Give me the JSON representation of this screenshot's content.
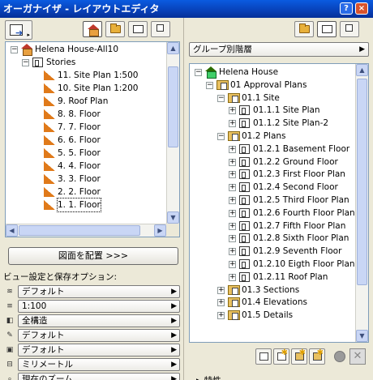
{
  "titlebar": {
    "title": "オーガナイザ - レイアウトエディタ",
    "help": "?",
    "close": "×"
  },
  "left": {
    "tree": {
      "items": [
        {
          "label": "Helena House-All10",
          "indent": 0,
          "expander": "−",
          "icon": "house"
        },
        {
          "label": "Stories",
          "indent": 1,
          "expander": "−",
          "icon": "stories"
        },
        {
          "label": "11. Site Plan 1:500",
          "indent": 2,
          "icon": "story"
        },
        {
          "label": "10. Site Plan 1:200",
          "indent": 2,
          "icon": "story"
        },
        {
          "label": "9. Roof Plan",
          "indent": 2,
          "icon": "story"
        },
        {
          "label": "8. 8. Floor",
          "indent": 2,
          "icon": "story"
        },
        {
          "label": "7. 7. Floor",
          "indent": 2,
          "icon": "story"
        },
        {
          "label": "6. 6. Floor",
          "indent": 2,
          "icon": "story"
        },
        {
          "label": "5. 5. Floor",
          "indent": 2,
          "icon": "story"
        },
        {
          "label": "4. 4. Floor",
          "indent": 2,
          "icon": "story"
        },
        {
          "label": "3. 3. Floor",
          "indent": 2,
          "icon": "story"
        },
        {
          "label": "2. 2. Floor",
          "indent": 2,
          "icon": "story"
        },
        {
          "label": "1. 1. Floor",
          "indent": 2,
          "icon": "story",
          "selected": true
        }
      ]
    },
    "place_button": "図面を配置 >>>",
    "options_label": "ビュー設定と保存オプション:",
    "options": [
      {
        "icon": "layers-icon",
        "glyph": "≋",
        "value": "デフォルト"
      },
      {
        "icon": "scale-icon",
        "glyph": "≡",
        "value": "1:100"
      },
      {
        "icon": "structure-icon",
        "glyph": "◧",
        "value": "全構造"
      },
      {
        "icon": "pen-icon",
        "glyph": "✎",
        "value": "デフォルト"
      },
      {
        "icon": "model-view-icon",
        "glyph": "▣",
        "value": "デフォルト"
      },
      {
        "icon": "dimension-icon",
        "glyph": "⊟",
        "value": "ミリメートル"
      },
      {
        "icon": "zoom-icon",
        "glyph": "⌕",
        "value": "現在のズーム"
      }
    ]
  },
  "right": {
    "hierarchy_select": "グループ別階層",
    "tree": {
      "items": [
        {
          "label": "Helena House",
          "indent": 0,
          "expander": "−",
          "icon": "book"
        },
        {
          "label": "01 Approval Plans",
          "indent": 1,
          "expander": "−",
          "icon": "folder"
        },
        {
          "label": "01.1 Site",
          "indent": 2,
          "expander": "−",
          "icon": "folder"
        },
        {
          "label": "01.1.1 Site Plan",
          "indent": 3,
          "expander": "+",
          "icon": "sheet"
        },
        {
          "label": "01.1.2 Site Plan-2",
          "indent": 3,
          "expander": "+",
          "icon": "sheet"
        },
        {
          "label": "01.2 Plans",
          "indent": 2,
          "expander": "−",
          "icon": "folder"
        },
        {
          "label": "01.2.1 Basement Floor",
          "indent": 3,
          "expander": "+",
          "icon": "sheet"
        },
        {
          "label": "01.2.2 Ground Floor",
          "indent": 3,
          "expander": "+",
          "icon": "sheet"
        },
        {
          "label": "01.2.3 First Floor Plan",
          "indent": 3,
          "expander": "+",
          "icon": "sheet"
        },
        {
          "label": "01.2.4 Second Floor",
          "indent": 3,
          "expander": "+",
          "icon": "sheet"
        },
        {
          "label": "01.2.5 Third Floor Plan",
          "indent": 3,
          "expander": "+",
          "icon": "sheet"
        },
        {
          "label": "01.2.6 Fourth Floor Plan",
          "indent": 3,
          "expander": "+",
          "icon": "sheet"
        },
        {
          "label": "01.2.7 Fifth Floor Plan",
          "indent": 3,
          "expander": "+",
          "icon": "sheet"
        },
        {
          "label": "01.2.8 Sixth Floor Plan",
          "indent": 3,
          "expander": "+",
          "icon": "sheet"
        },
        {
          "label": "01.2.9 Seventh Floor",
          "indent": 3,
          "expander": "+",
          "icon": "sheet"
        },
        {
          "label": "01.2.10 Eigth Floor Plan",
          "indent": 3,
          "expander": "+",
          "icon": "sheet"
        },
        {
          "label": "01.2.11 Roof Plan",
          "indent": 3,
          "expander": "+",
          "icon": "sheet"
        },
        {
          "label": "01.3 Sections",
          "indent": 2,
          "expander": "+",
          "icon": "folder"
        },
        {
          "label": "01.4 Elevations",
          "indent": 2,
          "expander": "+",
          "icon": "folder"
        },
        {
          "label": "01.5 Details",
          "indent": 2,
          "expander": "+",
          "icon": "folder"
        }
      ]
    },
    "properties_label": "特性"
  }
}
